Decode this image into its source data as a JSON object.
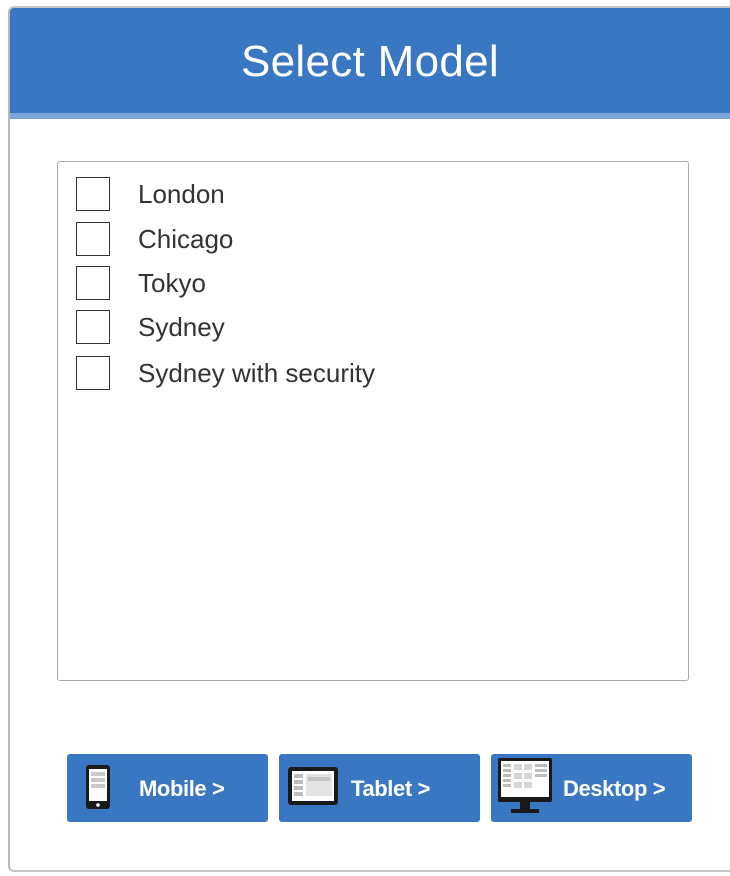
{
  "header": {
    "title": "Select Model"
  },
  "models": [
    {
      "label": "London",
      "checked": false
    },
    {
      "label": "Chicago",
      "checked": false
    },
    {
      "label": "Tokyo",
      "checked": false
    },
    {
      "label": "Sydney",
      "checked": false
    },
    {
      "label": "Sydney with security",
      "checked": false
    }
  ],
  "buttons": {
    "mobile": {
      "label": "Mobile >",
      "icon": "mobile-phone-icon"
    },
    "tablet": {
      "label": "Tablet >",
      "icon": "tablet-icon"
    },
    "desktop": {
      "label": "Desktop >",
      "icon": "desktop-monitor-icon"
    }
  },
  "colors": {
    "accent": "#3a77c2",
    "header_underline": "#7da6d8"
  }
}
